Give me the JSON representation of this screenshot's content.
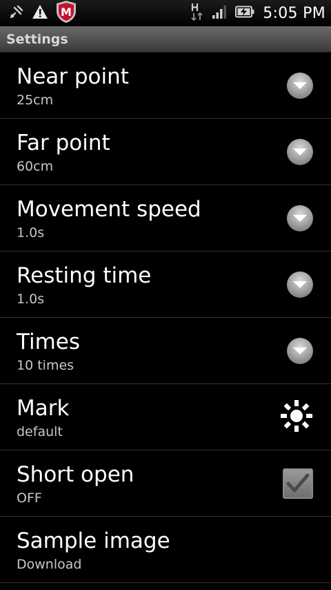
{
  "status_bar": {
    "time": "5:05 PM",
    "icons": [
      "usb-debug-icon",
      "warning-icon",
      "mcafee-shield-icon",
      "hspa-data-icon",
      "signal-bars-icon",
      "battery-charging-icon"
    ],
    "shield_letter": "M"
  },
  "header": {
    "title": "Settings"
  },
  "settings": {
    "items": [
      {
        "title": "Near point",
        "summary": "25cm",
        "control": "dropdown"
      },
      {
        "title": "Far point",
        "summary": "60cm",
        "control": "dropdown"
      },
      {
        "title": "Movement speed",
        "summary": "1.0s",
        "control": "dropdown"
      },
      {
        "title": "Resting time",
        "summary": "1.0s",
        "control": "dropdown"
      },
      {
        "title": "Times",
        "summary": "10 times",
        "control": "dropdown"
      },
      {
        "title": "Mark",
        "summary": "default",
        "control": "mark-preview"
      },
      {
        "title": "Short open",
        "summary": "OFF",
        "control": "checkbox",
        "checked": true
      },
      {
        "title": "Sample image",
        "summary": "Download",
        "control": "none"
      }
    ]
  },
  "colors": {
    "background": "#000000",
    "title_bar": "#4a4a4a",
    "divider": "#333333",
    "summary_text": "#c8c8c8"
  }
}
